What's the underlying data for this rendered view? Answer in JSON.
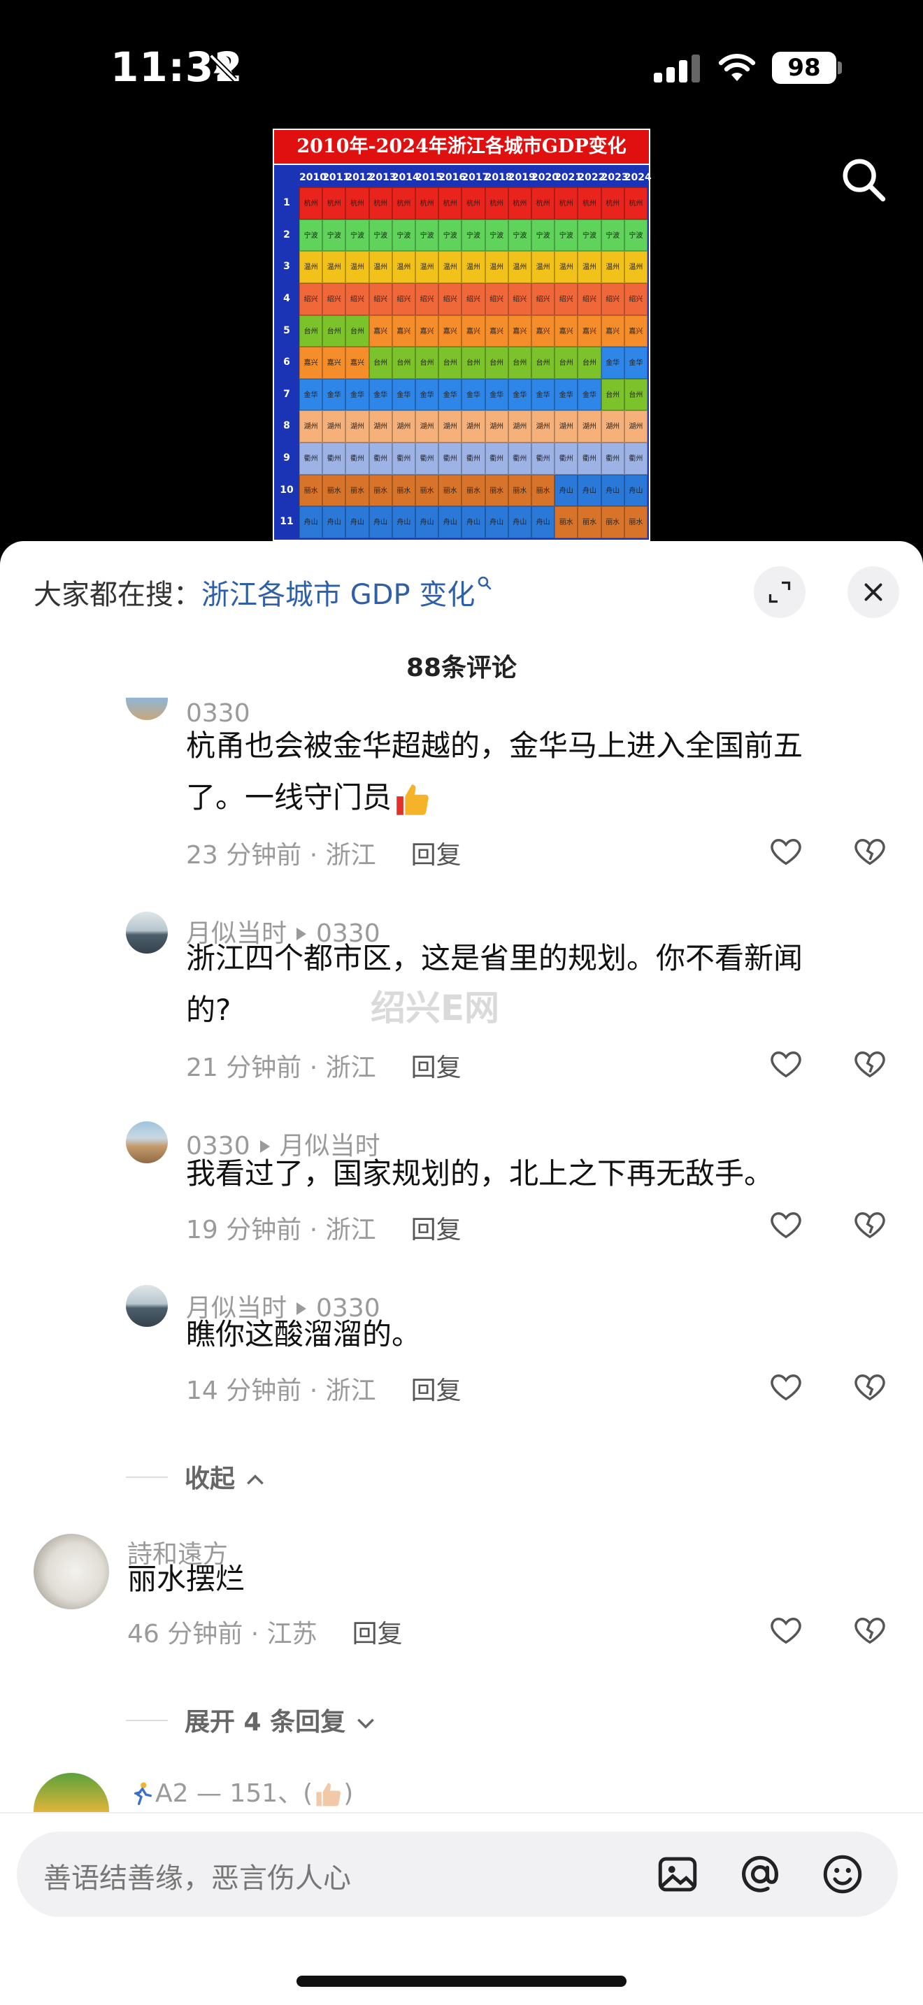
{
  "status_bar": {
    "time": "11:32",
    "battery": "98"
  },
  "gdp_image": {
    "title": "2010年-2024年浙江各城市GDP变化",
    "years": [
      "2010",
      "2011",
      "2012",
      "2013",
      "2014",
      "2015",
      "2016",
      "2017",
      "2018",
      "2019",
      "2020",
      "2021",
      "2022",
      "2023",
      "2024"
    ],
    "ranks": [
      "1",
      "2",
      "3",
      "4",
      "5",
      "6",
      "7",
      "8",
      "9",
      "10",
      "11"
    ],
    "rows": [
      {
        "cells": [
          "杭州",
          "杭州",
          "杭州",
          "杭州",
          "杭州",
          "杭州",
          "杭州",
          "杭州",
          "杭州",
          "杭州",
          "杭州",
          "杭州",
          "杭州",
          "杭州",
          "杭州"
        ],
        "colors": [
          "#e8241c",
          "#e8241c",
          "#e8241c",
          "#e8241c",
          "#e8241c",
          "#e8241c",
          "#e8241c",
          "#e8241c",
          "#e8241c",
          "#e8241c",
          "#e8241c",
          "#e8241c",
          "#e8241c",
          "#e8241c",
          "#e8241c"
        ]
      },
      {
        "cells": [
          "宁波",
          "宁波",
          "宁波",
          "宁波",
          "宁波",
          "宁波",
          "宁波",
          "宁波",
          "宁波",
          "宁波",
          "宁波",
          "宁波",
          "宁波",
          "宁波",
          "宁波"
        ],
        "colors": [
          "#5fd35a",
          "#5fd35a",
          "#5fd35a",
          "#5fd35a",
          "#5fd35a",
          "#5fd35a",
          "#5fd35a",
          "#5fd35a",
          "#5fd35a",
          "#5fd35a",
          "#5fd35a",
          "#5fd35a",
          "#5fd35a",
          "#5fd35a",
          "#5fd35a"
        ]
      },
      {
        "cells": [
          "温州",
          "温州",
          "温州",
          "温州",
          "温州",
          "温州",
          "温州",
          "温州",
          "温州",
          "温州",
          "温州",
          "温州",
          "温州",
          "温州",
          "温州"
        ],
        "colors": [
          "#f2c21a",
          "#f2c21a",
          "#f2c21a",
          "#f2c21a",
          "#f2c21a",
          "#f2c21a",
          "#f2c21a",
          "#f2c21a",
          "#f2c21a",
          "#f2c21a",
          "#f2c21a",
          "#f2c21a",
          "#f2c21a",
          "#f2c21a",
          "#f2c21a"
        ]
      },
      {
        "cells": [
          "绍兴",
          "绍兴",
          "绍兴",
          "绍兴",
          "绍兴",
          "绍兴",
          "绍兴",
          "绍兴",
          "绍兴",
          "绍兴",
          "绍兴",
          "绍兴",
          "绍兴",
          "绍兴",
          "绍兴"
        ],
        "colors": [
          "#f0683a",
          "#f0683a",
          "#f0683a",
          "#f0683a",
          "#f0683a",
          "#f0683a",
          "#f0683a",
          "#f0683a",
          "#f0683a",
          "#f0683a",
          "#f0683a",
          "#f0683a",
          "#f0683a",
          "#f0683a",
          "#f0683a"
        ]
      },
      {
        "cells": [
          "台州",
          "台州",
          "台州",
          "嘉兴",
          "嘉兴",
          "嘉兴",
          "嘉兴",
          "嘉兴",
          "嘉兴",
          "嘉兴",
          "嘉兴",
          "嘉兴",
          "嘉兴",
          "嘉兴",
          "嘉兴"
        ],
        "colors": [
          "#7cc22a",
          "#7cc22a",
          "#7cc22a",
          "#f58d2a",
          "#f58d2a",
          "#f58d2a",
          "#f58d2a",
          "#f58d2a",
          "#f58d2a",
          "#f58d2a",
          "#f58d2a",
          "#f58d2a",
          "#f58d2a",
          "#f58d2a",
          "#f58d2a"
        ]
      },
      {
        "cells": [
          "嘉兴",
          "嘉兴",
          "嘉兴",
          "台州",
          "台州",
          "台州",
          "台州",
          "台州",
          "台州",
          "台州",
          "台州",
          "台州",
          "台州",
          "金华",
          "金华"
        ],
        "colors": [
          "#f58d2a",
          "#f58d2a",
          "#f58d2a",
          "#7cc22a",
          "#7cc22a",
          "#7cc22a",
          "#7cc22a",
          "#7cc22a",
          "#7cc22a",
          "#7cc22a",
          "#7cc22a",
          "#7cc22a",
          "#7cc22a",
          "#2e86e8",
          "#2e86e8"
        ]
      },
      {
        "cells": [
          "金华",
          "金华",
          "金华",
          "金华",
          "金华",
          "金华",
          "金华",
          "金华",
          "金华",
          "金华",
          "金华",
          "金华",
          "金华",
          "台州",
          "台州"
        ],
        "colors": [
          "#2e86e8",
          "#2e86e8",
          "#2e86e8",
          "#2e86e8",
          "#2e86e8",
          "#2e86e8",
          "#2e86e8",
          "#2e86e8",
          "#2e86e8",
          "#2e86e8",
          "#2e86e8",
          "#2e86e8",
          "#2e86e8",
          "#7cc22a",
          "#7cc22a"
        ]
      },
      {
        "cells": [
          "湖州",
          "湖州",
          "湖州",
          "湖州",
          "湖州",
          "湖州",
          "湖州",
          "湖州",
          "湖州",
          "湖州",
          "湖州",
          "湖州",
          "湖州",
          "湖州",
          "湖州"
        ],
        "colors": [
          "#f6b07a",
          "#f6b07a",
          "#f6b07a",
          "#f6b07a",
          "#f6b07a",
          "#f6b07a",
          "#f6b07a",
          "#f6b07a",
          "#f6b07a",
          "#f6b07a",
          "#f6b07a",
          "#f6b07a",
          "#f6b07a",
          "#f6b07a",
          "#f6b07a"
        ]
      },
      {
        "cells": [
          "衢州",
          "衢州",
          "衢州",
          "衢州",
          "衢州",
          "衢州",
          "衢州",
          "衢州",
          "衢州",
          "衢州",
          "衢州",
          "衢州",
          "衢州",
          "衢州",
          "衢州"
        ],
        "colors": [
          "#9db3e6",
          "#9db3e6",
          "#9db3e6",
          "#9db3e6",
          "#9db3e6",
          "#9db3e6",
          "#9db3e6",
          "#9db3e6",
          "#9db3e6",
          "#9db3e6",
          "#9db3e6",
          "#9db3e6",
          "#9db3e6",
          "#9db3e6",
          "#9db3e6"
        ]
      },
      {
        "cells": [
          "丽水",
          "丽水",
          "丽水",
          "丽水",
          "丽水",
          "丽水",
          "丽水",
          "丽水",
          "丽水",
          "丽水",
          "丽水",
          "舟山",
          "舟山",
          "舟山",
          "舟山"
        ],
        "colors": [
          "#d8742a",
          "#d8742a",
          "#d8742a",
          "#d8742a",
          "#d8742a",
          "#d8742a",
          "#d8742a",
          "#d8742a",
          "#d8742a",
          "#d8742a",
          "#d8742a",
          "#2a78d8",
          "#2a78d8",
          "#2a78d8",
          "#2a78d8"
        ]
      },
      {
        "cells": [
          "舟山",
          "舟山",
          "舟山",
          "舟山",
          "舟山",
          "舟山",
          "舟山",
          "舟山",
          "舟山",
          "舟山",
          "舟山",
          "丽水",
          "丽水",
          "丽水",
          "丽水"
        ],
        "colors": [
          "#2a78d8",
          "#2a78d8",
          "#2a78d8",
          "#2a78d8",
          "#2a78d8",
          "#2a78d8",
          "#2a78d8",
          "#2a78d8",
          "#2a78d8",
          "#2a78d8",
          "#2a78d8",
          "#d8742a",
          "#d8742a",
          "#d8742a",
          "#d8742a"
        ]
      }
    ]
  },
  "sheet": {
    "hot_search_prefix": "大家都在搜：",
    "hot_search_term": "浙江各城市 GDP 变化",
    "comment_count": "88条评论",
    "comments": [
      {
        "name": "0330",
        "reply_to": "",
        "text_line1": "杭甬也会被金华超越的，金华马上进入全国前五",
        "text_line2": "了。一线守门员",
        "time_loc": "23 分钟前 · 浙江",
        "reply": "回复"
      },
      {
        "name": "月似当时",
        "reply_to": "0330",
        "text_line1": "浙江四个都市区，这是省里的规划。你不看新闻",
        "text_line2": "的?",
        "time_loc": "21 分钟前 · 浙江",
        "reply": "回复"
      },
      {
        "name": "0330",
        "reply_to": "月似当时",
        "text_line1": "我看过了，国家规划的，北上之下再无敌手。",
        "text_line2": "",
        "time_loc": "19 分钟前 · 浙江",
        "reply": "回复"
      },
      {
        "name": "月似当时",
        "reply_to": "0330",
        "text_line1": "瞧你这酸溜溜的。",
        "text_line2": "",
        "time_loc": "14 分钟前 · 浙江",
        "reply": "回复"
      }
    ],
    "collapse_label": "收起",
    "top_comment": {
      "name": "詩和遠方",
      "text": "丽水摆烂",
      "time_loc": "46 分钟前 · 江苏",
      "reply": "回复"
    },
    "expand_label": "展开 4 条回复",
    "next_comment_name": "A2 — 151、(",
    "watermark": "绍兴E网",
    "input_placeholder": "善语结善缘，恶言伤人心"
  }
}
